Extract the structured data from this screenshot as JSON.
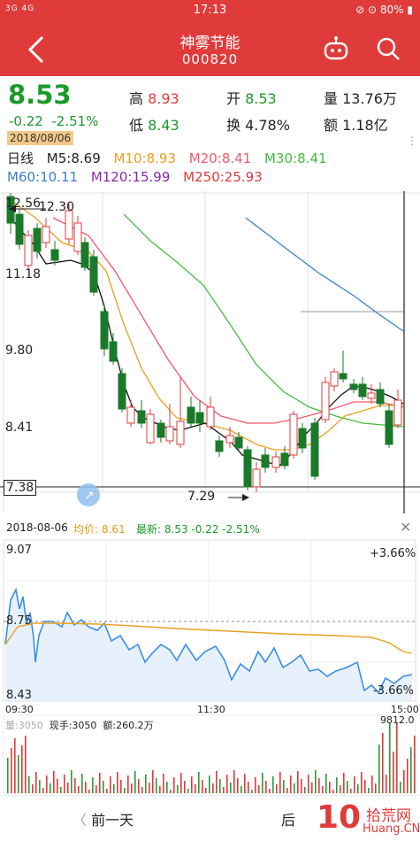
{
  "status_bar": {
    "signal": "3G 4G",
    "time": "17:13",
    "battery": "80%"
  },
  "header": {
    "title": "神雾节能",
    "code": "000820"
  },
  "quote": {
    "price": "8.53",
    "change": "-0.22",
    "change_pct": "-2.51%",
    "date": "2018/08/06",
    "high_label": "高",
    "high": "8.93",
    "low_label": "低",
    "low": "8.43",
    "open_label": "开",
    "open": "8.53",
    "turnover_label": "换",
    "turnover": "4.78%",
    "volume_label": "量",
    "volume": "13.76万",
    "amount_label": "额",
    "amount": "1.18亿"
  },
  "ma": {
    "period": "日线",
    "m5": "M5:8.69",
    "m10": "M10:8.93",
    "m20": "M20:8.41",
    "m30": "M30:8.41",
    "m60": "M60:10.11",
    "m120": "M120:15.99",
    "m250": "M250:25.93"
  },
  "kline": {
    "y_labels": [
      "12.56",
      "11.18",
      "9.80",
      "8.41",
      "7.38"
    ],
    "high_mark": "12.30",
    "low_mark": "7.29",
    "colors": {
      "up": "#e03b3b",
      "down": "#1a7a2a",
      "m5": "#222222",
      "m10": "#e8a020",
      "m20": "#ee5a6a",
      "m30": "#44bb44",
      "m60": "#3a7fc8"
    }
  },
  "intraday": {
    "date": "2018-08-06",
    "avg_label": "均价:",
    "avg": "8.61",
    "latest_label": "最新:",
    "latest": "8.53 -0.22 -2.51%",
    "price_high": "9.07",
    "price_mid": "8.75",
    "price_low": "8.43",
    "pct_high": "+3.66%",
    "pct_low": "-3.66%",
    "time_start": "09:30",
    "time_mid": "11:30",
    "time_end": "15:00",
    "vol_label": "量:3050",
    "now_hand": "现手:3050",
    "amount": "额:260.2万",
    "vol_max": "9812.0"
  },
  "footer": {
    "prev": "前一天",
    "next": "后",
    "watermark_num": "10",
    "watermark_cn": "拾荒网",
    "watermark_site": "Huang.CN"
  }
}
